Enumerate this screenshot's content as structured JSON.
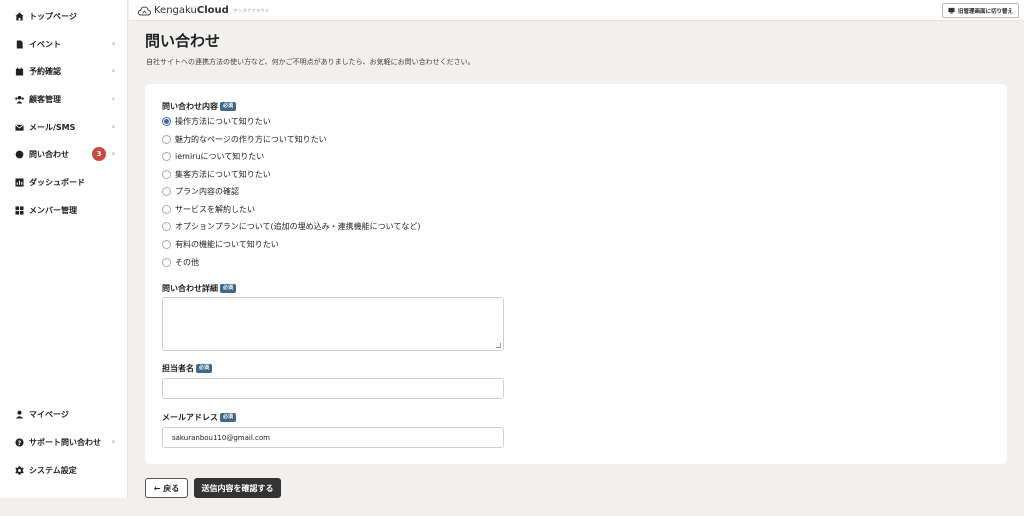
{
  "sidebar": {
    "items": [
      {
        "label": "トップページ",
        "icon": "home-icon"
      },
      {
        "label": "イベント",
        "icon": "document-icon",
        "chevron": "›"
      },
      {
        "label": "予約確認",
        "icon": "calendar-icon",
        "chevron": "›"
      },
      {
        "label": "顧客管理",
        "icon": "users-icon",
        "chevron": "›"
      },
      {
        "label": "メール/SMS",
        "icon": "mail-icon",
        "chevron": "›"
      },
      {
        "label": "問い合わせ",
        "icon": "chat-icon",
        "chevron": "›",
        "badge": "3"
      },
      {
        "label": "ダッシュボード",
        "icon": "chart-icon"
      },
      {
        "label": "メンバー管理",
        "icon": "grid-icon"
      }
    ],
    "bottom_items": [
      {
        "label": "マイページ",
        "icon": "person-icon"
      },
      {
        "label": "サポート問い合わせ",
        "icon": "help-icon",
        "chevron": "›"
      },
      {
        "label": "システム設定",
        "icon": "gear-icon"
      }
    ]
  },
  "header": {
    "logo_text_1": "Kengaku",
    "logo_text_2": "Cloud",
    "logo_sub": "ケンガククラウド",
    "switch_label": "旧管理画面に切り替え"
  },
  "page": {
    "title": "問い合わせ",
    "description": "自社サイトへの連携方法の使い方など、何かご不明点がありましたら、お気軽にお問い合わせください。"
  },
  "form": {
    "required_label": "必須",
    "inquiry_type": {
      "label": "問い合わせ内容",
      "options": [
        "操作方法について知りたい",
        "魅力的なページの作り方について知りたい",
        "iemiruについて知りたい",
        "集客方法について知りたい",
        "プラン内容の確認",
        "サービスを解約したい",
        "オプションプランについて(追加の埋め込み・連携機能についてなど)",
        "有料の機能について知りたい",
        "その他"
      ],
      "selected_index": 0
    },
    "details": {
      "label": "問い合わせ詳細",
      "value": ""
    },
    "person": {
      "label": "担当者名",
      "value": ""
    },
    "email": {
      "label": "メールアドレス",
      "value": "sakuranbou110@gmail.com"
    }
  },
  "actions": {
    "back_label": "← 戻る",
    "submit_label": "送信内容を確認する"
  },
  "colors": {
    "accent": "#3c6d9c",
    "badge": "#c84a3e",
    "required_tag": "#3f6a8a",
    "submit": "#333333"
  }
}
